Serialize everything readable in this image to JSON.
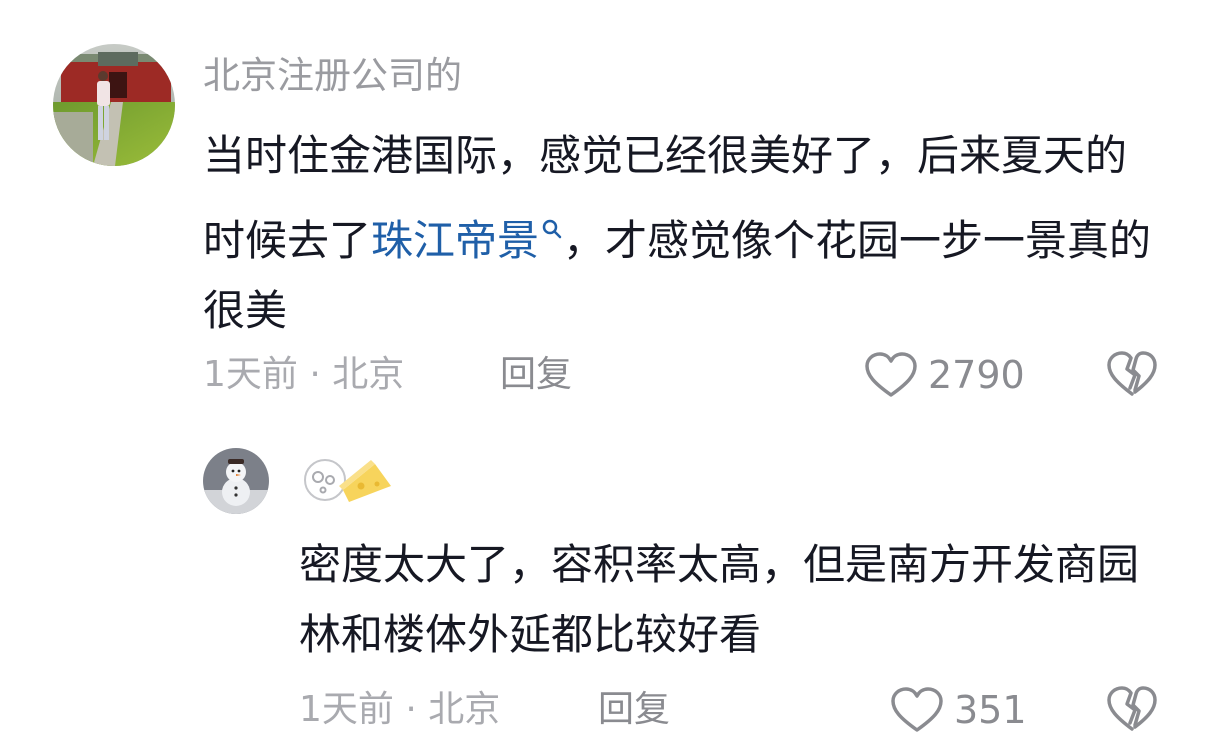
{
  "comments": [
    {
      "username": "北京注册公司的",
      "text_before": "当时住金港国际，感觉已经很美好了，后来夏天的时候去了",
      "link_text": "珠江帝景",
      "text_after": "，才感觉像个花园一步一景真的很美",
      "time_location": "1天前 · 北京",
      "reply_label": "回复",
      "like_count": "2790",
      "icons": {
        "like": "heart-outline-icon",
        "dislike": "broken-heart-icon",
        "link": "search-icon"
      }
    }
  ],
  "reply": {
    "text": "密度太大了，容积率太高，但是南方开发商园林和楼体外延都比较好看",
    "time_location": "1天前 · 北京",
    "reply_label": "回复",
    "like_count": "351",
    "icons": {
      "username": "cheese-emoji-icon",
      "like": "heart-outline-icon",
      "dislike": "broken-heart-icon"
    }
  },
  "colors": {
    "link": "#1f5fa8",
    "meta": "#a9aaaf",
    "username": "#9a9ba0",
    "text": "#161823"
  }
}
